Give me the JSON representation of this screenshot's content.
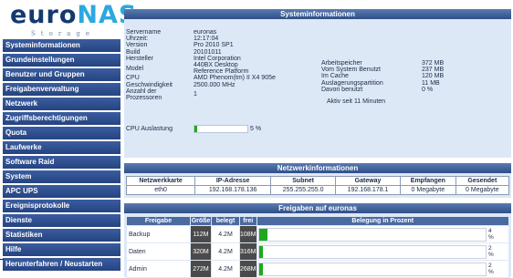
{
  "logo": {
    "prefix": "euro",
    "accent": "NAS",
    "sub": "Storage"
  },
  "menu": [
    "Systeminformationen",
    "Grundeinstellungen",
    "Benutzer und Gruppen",
    "Freigabenverwaltung",
    "Netzwerk",
    "Zugriffsberechtigungen",
    "Quota",
    "Laufwerke",
    "Software Raid",
    "System",
    "APC UPS",
    "Ereignisprotokolle",
    "Dienste",
    "Statistiken",
    "Hilfe",
    "Herunterfahren / Neustarten"
  ],
  "sysinfo": {
    "title": "Systeminformationen",
    "left": [
      {
        "k": "Servername",
        "v": "euronas"
      },
      {
        "k": "Uhrzeit:",
        "v": "12:17:04"
      },
      {
        "k": "Version",
        "v": "Pro 2010 SP1"
      },
      {
        "k": "Build",
        "v": "20101011"
      },
      {
        "k": "Hersteller",
        "v": "Intel Corporation"
      },
      {
        "k": "Model",
        "v": "440BX Desktop Reference Platform"
      },
      {
        "k": "CPU",
        "v": "AMD Phenom(tm) II X4 905e"
      },
      {
        "k": "Geschwindigkeit",
        "v": "2500.000 MHz"
      },
      {
        "k": "Anzahl der Prozessoren",
        "v": "1"
      }
    ],
    "right": [
      {
        "k": "Arbeitspeicher",
        "v": "372 MB"
      },
      {
        "k": "Vom System Benutzt",
        "v": "237 MB"
      },
      {
        "k": "Im Cache",
        "v": "120 MB"
      },
      {
        "k": "Auslagerungspartition",
        "v": "11 MB"
      },
      {
        "k": "Davon benutzt",
        "v": "0 %"
      }
    ],
    "uptime": "Aktiv seit 11 Minuten",
    "cpu_label": "CPU Auslastung",
    "cpu_pct_text": "5 %",
    "cpu_pct": 5
  },
  "network": {
    "title": "Netzwerkinformationen",
    "headers": [
      "Netzwerkkarte",
      "IP-Adresse",
      "Subnet",
      "Gateway",
      "Empfangen",
      "Gesendet"
    ],
    "rows": [
      [
        "eth0",
        "192.168.178.136",
        "255.255.255.0",
        "192.168.178.1",
        "0 Megabyte",
        "0 Megabyte"
      ]
    ]
  },
  "shares": {
    "title": "Freigaben auf euronas",
    "headers": [
      "Freigabe",
      "Größe",
      "belegt",
      "frei",
      "Belegung in Prozent"
    ],
    "rows": [
      {
        "name": "Backup",
        "size": "112M",
        "used": "4.2M",
        "free": "108M",
        "pct": 4,
        "pct_text": "4\n%"
      },
      {
        "name": "Daten",
        "size": "320M",
        "used": "4.2M",
        "free": "316M",
        "pct": 2,
        "pct_text": "2\n%"
      },
      {
        "name": "Admin",
        "size": "272M",
        "used": "4.2M",
        "free": "268M",
        "pct": 2,
        "pct_text": "2\n%"
      }
    ]
  },
  "colors": {
    "menu": "#2f4f8c",
    "panel": "#dde8f7",
    "bar": "#1fa81f",
    "logo": "#123a6e",
    "logo_accent": "#2ca8e0"
  }
}
